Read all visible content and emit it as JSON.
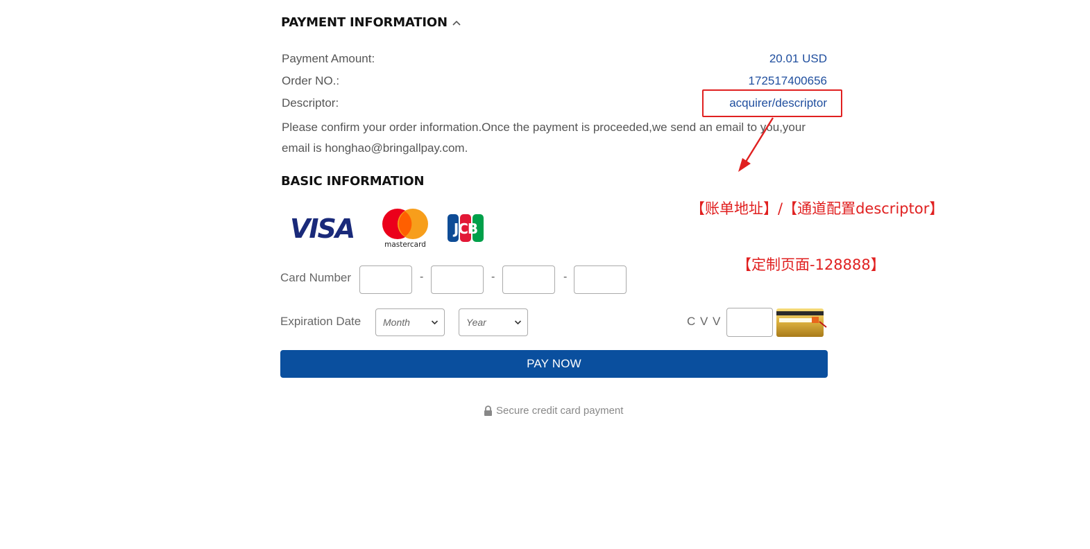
{
  "payment_section": {
    "title": "PAYMENT INFORMATION",
    "rows": [
      {
        "label": "Payment Amount:",
        "value": "20.01 USD"
      },
      {
        "label": "Order NO.:",
        "value": "172517400656"
      },
      {
        "label": "Descriptor:",
        "value": "acquirer/descriptor"
      }
    ],
    "notice_line1": "Please confirm your order information.Once the payment is proceeded,we send an email to you,your",
    "notice_line2": "email is honghao@bringallpay.com."
  },
  "basic_section": {
    "title": "BASIC INFORMATION",
    "card_brands": [
      "VISA",
      "mastercard",
      "JCB"
    ]
  },
  "form": {
    "card_number_label": "Card Number",
    "dash": "-",
    "expiration_label": "Expiration Date",
    "month_placeholder": "Month",
    "year_placeholder": "Year",
    "cvv_label": "C V V",
    "pay_button": "PAY NOW",
    "secure_text": "Secure credit card payment"
  },
  "annotations": {
    "descriptor_note": "【账单地址】/【通道配置descriptor】",
    "page_note": "【定制页面-128888】",
    "color": "#e02020"
  },
  "colors": {
    "accent": "#0a4f9e",
    "value_text": "#1f4e9e"
  }
}
